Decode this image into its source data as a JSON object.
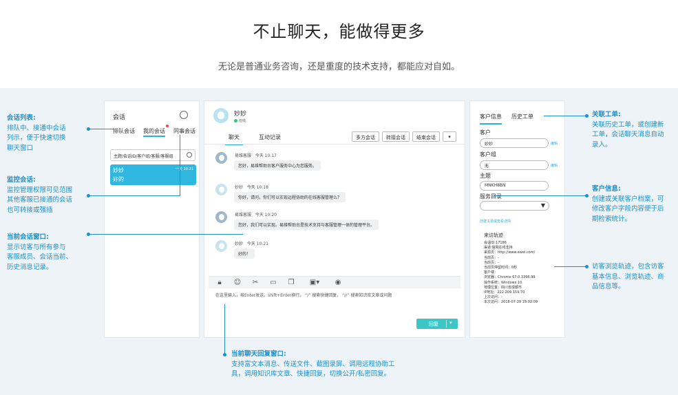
{
  "hero": {
    "title": "不止聊天，能做得更多",
    "subtitle": "无论是普通业务咨询，还是重度的技术支持，都能应对自如。"
  },
  "left_panel": {
    "title": "会话",
    "tabs": [
      "排队会话",
      "我的会话",
      "同事会话"
    ],
    "search_placeholder": "主题/会话ID/客户组/客服/客服组",
    "active_session": {
      "name": "妙妙",
      "message": "好的",
      "time": "一天 10:21"
    }
  },
  "chat": {
    "contact_name": "妙妙",
    "contact_status": "在线",
    "tabs": [
      "聊天",
      "互动记录"
    ],
    "actions": [
      "多方会话",
      "转接会话",
      "结束会话"
    ],
    "messages": [
      {
        "sender": "易维客服",
        "time": "今天 10:17",
        "text": "您好，易维帮助台客户服务中心为您服务。",
        "role": "agent"
      },
      {
        "sender": "妙妙",
        "time": "今天 10:18",
        "text": "你好，请问，你们可以实现远程协助的在线客服管理么？",
        "role": "visitor"
      },
      {
        "sender": "易维客服",
        "time": "今天 10:20",
        "text": "您好，我们可以实现。易维帮助台是技术支持与客服管理一体的管理平台。",
        "role": "agent"
      },
      {
        "sender": "妙妙",
        "time": "今天 10:21",
        "text": "好的！",
        "role": "visitor"
      }
    ],
    "toolbar_icons": [
      "lock-icon",
      "emoji-icon",
      "scissors-icon",
      "video-icon",
      "copy-icon",
      "window-icon",
      "webcam-icon"
    ],
    "input_placeholder": "在这里输入，按Enter发送，shift+Enter换行。 “/” 搜索快捷回复， “//” 搜索知识库文章或问题",
    "send_label": "回复"
  },
  "right_panel": {
    "tabs": [
      "客户信息",
      "历史工单"
    ],
    "fields": [
      {
        "label": "客户",
        "value": "妙妙",
        "link": "编辑"
      },
      {
        "label": "客户组",
        "value": "无",
        "link": "编辑"
      },
      {
        "label": "主题",
        "value": "MNKH8BN",
        "link": ""
      }
    ],
    "service_label": "服务目录",
    "create_link": "创建工单或查看详情",
    "track_title": "来访轨迹",
    "track_lines": [
      "会话ID:17186",
      "渠道:官网在线支持",
      "来源页：http://www.ewei.com/",
      "当前页：-",
      "当前页：-",
      "当前页停留时间：0秒",
      "客户端：",
      "浏览器：Chrome 67.0.3396.99",
      "操作系统：Windows 10",
      "地理位置：四川省成都市",
      "IP地址：222.209.159.70",
      "上次访问：-",
      "本次访问：2018-07-29 15:02:09"
    ]
  },
  "annotations": {
    "session_list": {
      "title": "会话列表:",
      "body": [
        "排队中、接通中会话",
        "列示，便于快速切换",
        "聊天窗口"
      ]
    },
    "monitor": {
      "title": "监控会话:",
      "body": [
        "监控管理权限可见范围",
        "其他客服已接通的会话",
        "也可转接或强插"
      ]
    },
    "current_window": {
      "title": "当前会话窗口:",
      "body": [
        "显示访客与所有参与",
        "客服成员、会话当前、",
        "历史消息记录。"
      ]
    },
    "reply_window": {
      "title": "当前聊天回复窗口:",
      "body": [
        "支持富文本消息、传送文件、截图录屏、调用远程协助工",
        "具，调用知识库文章、快捷回复，切换公开/私密回复。"
      ]
    },
    "ticket": {
      "title": "关联工单:",
      "body": [
        "关联历史工单，或创建新",
        "工单，会话聊天消息自动",
        "录入。"
      ]
    },
    "customer_info": {
      "title": "客户信息:",
      "body": [
        "创建或关联客户档案，可",
        "修改客户字段内容便于后",
        "期检索统计。"
      ]
    },
    "track": {
      "body": [
        "访客浏览轨迹，包含访客",
        "基本信息、浏览轨迹、商",
        "品信息等。"
      ]
    }
  }
}
